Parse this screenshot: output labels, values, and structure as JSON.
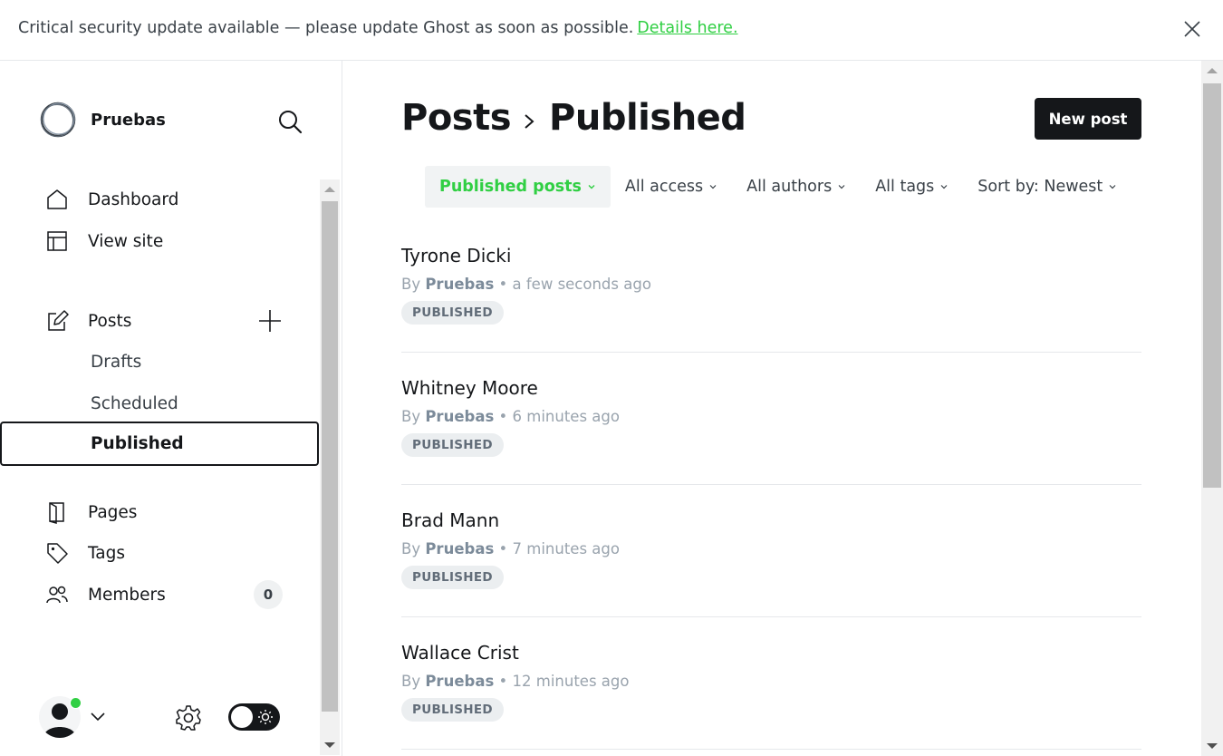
{
  "banner": {
    "text": "Critical security update available — please update Ghost as soon as possible.",
    "link": "Details here."
  },
  "sidebar": {
    "site_name": "Pruebas",
    "items": [
      {
        "label": "Dashboard",
        "icon": "home-icon"
      },
      {
        "label": "View site",
        "icon": "layout-icon"
      },
      {
        "label": "Posts",
        "icon": "edit-icon"
      },
      {
        "label": "Drafts"
      },
      {
        "label": "Scheduled"
      },
      {
        "label": "Published"
      },
      {
        "label": "Pages",
        "icon": "page-icon"
      },
      {
        "label": "Tags",
        "icon": "tag-icon"
      },
      {
        "label": "Members",
        "icon": "members-icon"
      }
    ],
    "members_count": "0"
  },
  "main": {
    "breadcrumb_parent": "Posts",
    "breadcrumb_current": "Published",
    "new_post": "New post",
    "filters": [
      {
        "label": "Published posts"
      },
      {
        "label": "All access"
      },
      {
        "label": "All authors"
      },
      {
        "label": "All tags"
      },
      {
        "label": "Sort by: Newest"
      }
    ],
    "posts": [
      {
        "title": "Tyrone Dicki",
        "by": "By",
        "author": "Pruebas",
        "time": "• a few seconds ago",
        "status": "PUBLISHED"
      },
      {
        "title": "Whitney Moore",
        "by": "By",
        "author": "Pruebas",
        "time": "• 6 minutes ago",
        "status": "PUBLISHED"
      },
      {
        "title": "Brad Mann",
        "by": "By",
        "author": "Pruebas",
        "time": "• 7 minutes ago",
        "status": "PUBLISHED"
      },
      {
        "title": "Wallace Crist",
        "by": "By",
        "author": "Pruebas",
        "time": "• 12 minutes ago",
        "status": "PUBLISHED"
      }
    ]
  },
  "colors": {
    "accent": "#30cf43",
    "dark": "#15171a"
  }
}
